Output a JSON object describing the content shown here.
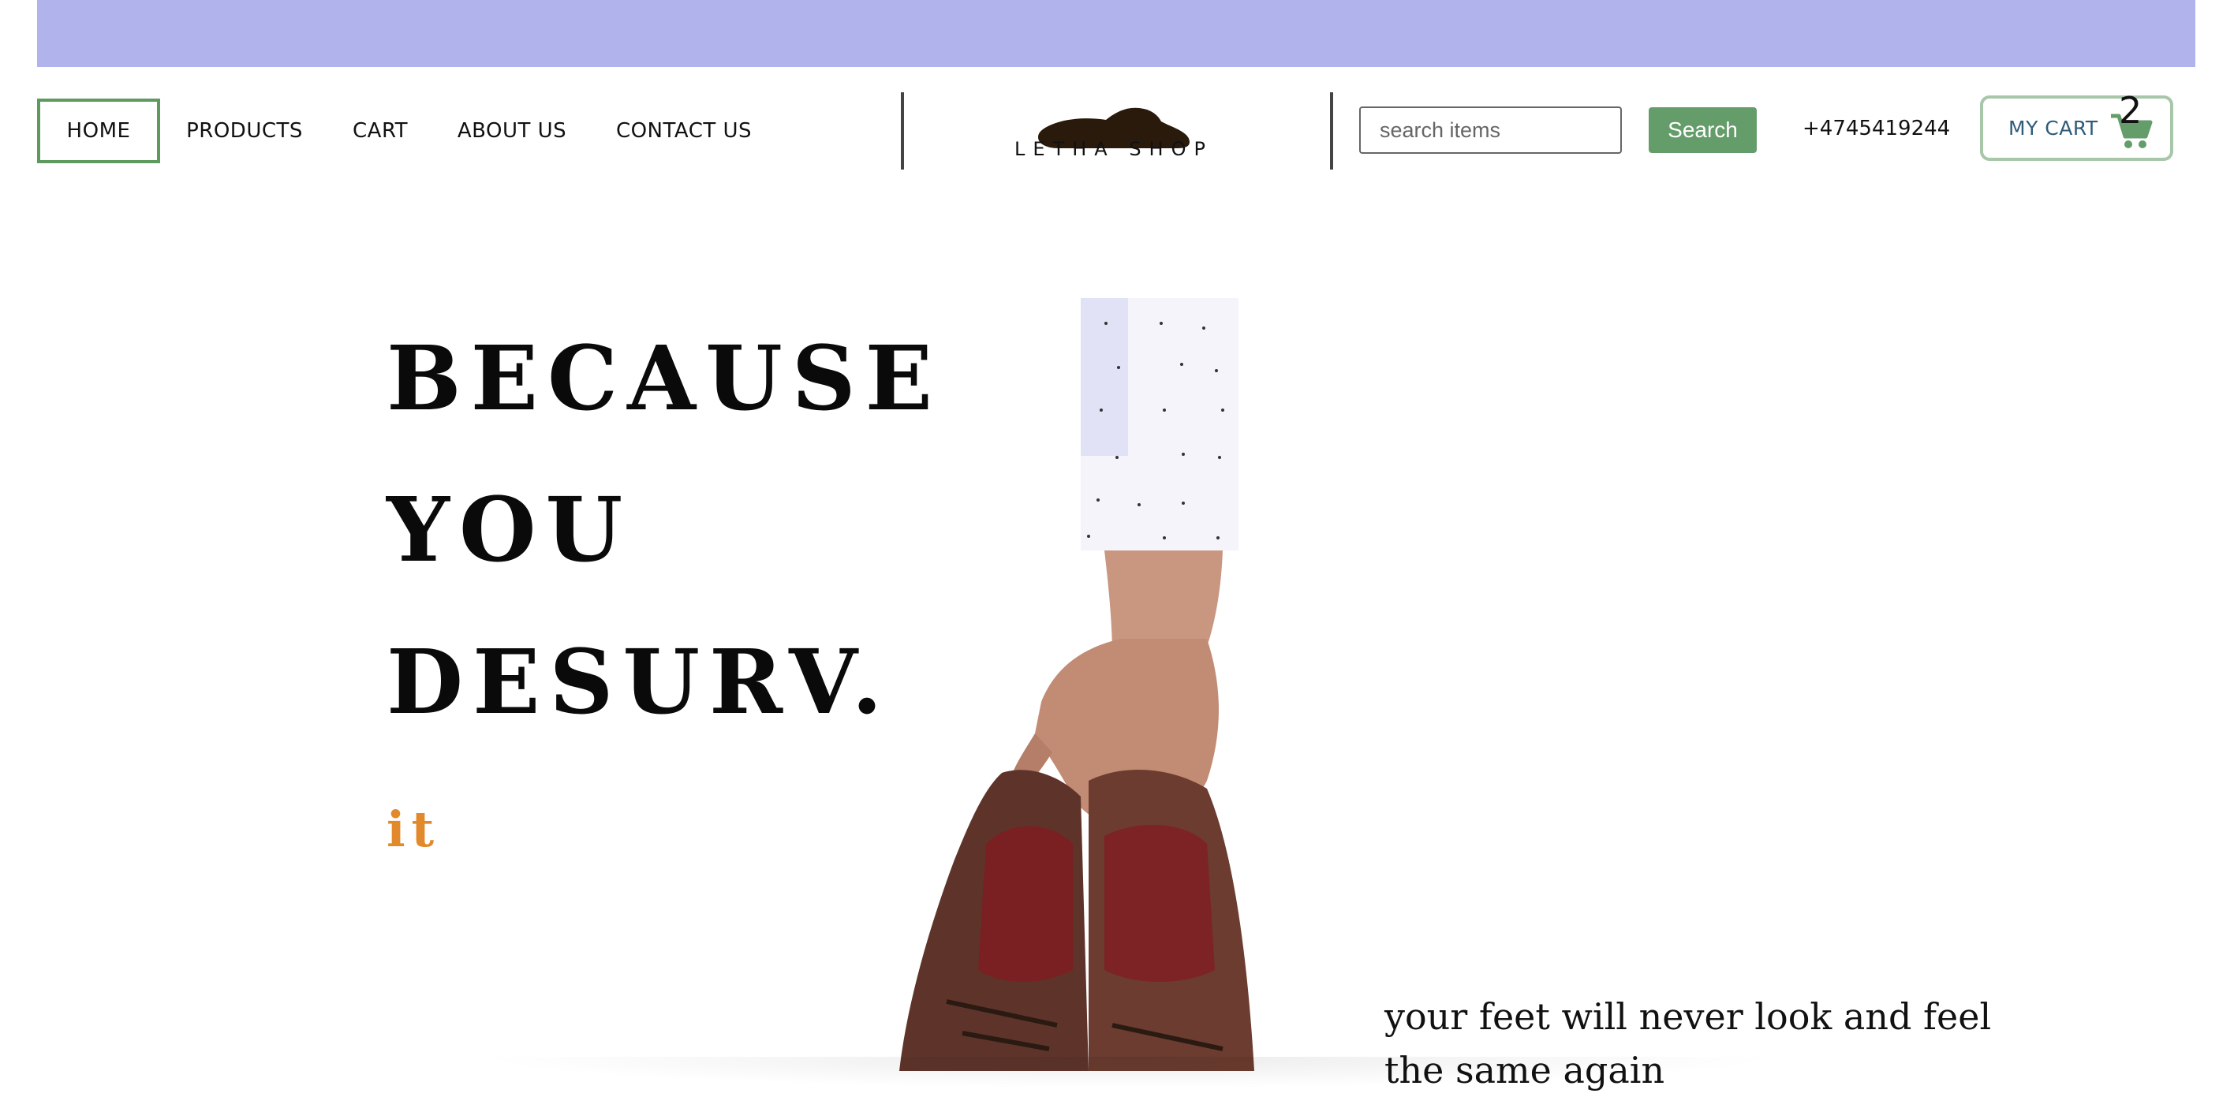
{
  "nav": {
    "items": [
      {
        "label": "HOME",
        "active": true
      },
      {
        "label": "PRODUCTS"
      },
      {
        "label": "CART"
      },
      {
        "label": "ABOUT US"
      },
      {
        "label": "CONTACT US"
      }
    ]
  },
  "brand": {
    "name": "LETHA SHOP",
    "logo_icon": "shoe-icon"
  },
  "search": {
    "placeholder": "search items",
    "value": "",
    "button_label": "Search"
  },
  "phone": "+4745419244",
  "cart": {
    "label": "MY CART",
    "count": "2",
    "icon": "shopping-cart-icon"
  },
  "hero": {
    "lines": [
      "BECAUSE",
      "YOU",
      "DESURV."
    ],
    "accent": "it",
    "tagline_line1": "your feet will never look and feel",
    "tagline_line2": "the same again"
  },
  "colors": {
    "topbar": "#b1b4ec",
    "accent_green": "#649c6a",
    "active_border": "#5e9a5e",
    "accent_orange": "#e28a2b",
    "cart_label": "#2e5c7a"
  }
}
